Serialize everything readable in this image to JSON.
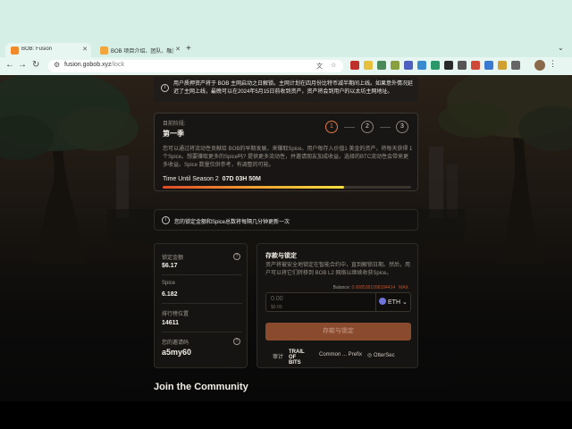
{
  "browser": {
    "tabs": [
      {
        "title": "BOB: Fusion",
        "active": true,
        "favicon_color": "#f08a2a"
      },
      {
        "title": "BOB 项目介绍、团队、融资与",
        "active": false,
        "favicon_color": "#f3a53a"
      }
    ],
    "new_tab": "+",
    "url_host": "fusion.gobob.xyz",
    "url_path": "/lock"
  },
  "notice": {
    "text": "用户质押资产将于 BOB 主网启动之日解锁。主网计划在四月份比特币减半期间上线。如果意外情况延迟了主网上线，最晚可以在2024年5月15日前收到资产，资产将会到用户的以太坊主网地址。"
  },
  "season": {
    "label": "目前阶段:",
    "name": "第一季",
    "steps": [
      "1",
      "2",
      "3"
    ],
    "active_step": 1,
    "description": "您可以通过将流动性贡献给 BOB的早期发展，来赚取Spice。用户每存入价值1 美金的资产，将每天获得 1 个Spice。想要赚取更多的Spice吗? 提供更多流动性，并邀请朋友加成收益。选择的BTC流动性会带来更多收益。Spice 数量仅供参考，有调整的可能。",
    "time_label": "Time Until Season 2",
    "time_value": "07D 03H 50M",
    "progress": 0.73
  },
  "update_notice": "您的锁定金额和Spice总数将每隔几分钟更新一次",
  "stats": {
    "locked_label": "锁定金额",
    "locked_value": "$6.17",
    "spice_label": "Spice",
    "spice_value": "6.182",
    "rank_label": "排行榜位置",
    "rank_value": "14611",
    "invite_label": "您的邀请码",
    "invite_value": "a5my60",
    "help": "?"
  },
  "deposit": {
    "title": "存款与锁定",
    "description": "资产将被安全地锁定在智能合约中，直到解锁日期。然后，用户可以将它们转移到 BOB L2 网络以继续收获Spice。",
    "balance_label": "Balance:",
    "balance_value": "0.0085381098184414",
    "max_label": "MAX",
    "amount_placeholder": "0.00",
    "usd_value": "$0.00",
    "token": "ETH",
    "button": "存款与锁定",
    "audit_label": "审计",
    "auditors": [
      "TRAIL OF BITS",
      "Common ... Prefix",
      "OtterSec"
    ]
  },
  "community_title": "Join the Community"
}
